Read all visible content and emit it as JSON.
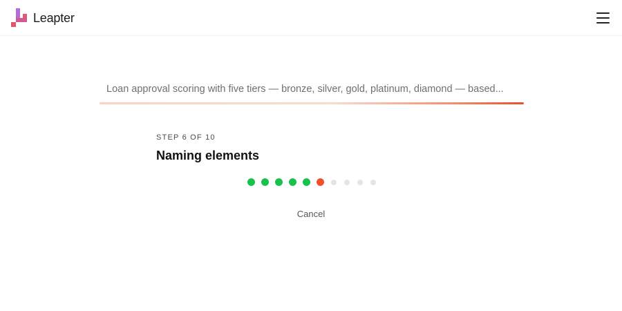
{
  "header": {
    "brand_name": "Leapter",
    "menu_icon": "hamburger-menu-icon"
  },
  "prompt": {
    "text": "Loan approval scoring with five tiers — bronze, silver, gold, platinum, diamond — based..."
  },
  "progress": {
    "step_label": "STEP 6 OF 10",
    "current_step": 6,
    "total_steps": 10,
    "title": "Naming elements",
    "colors": {
      "done": "#17c24c",
      "current": "#f0502a",
      "todo": "#e4e4e4"
    }
  },
  "actions": {
    "cancel_label": "Cancel"
  }
}
